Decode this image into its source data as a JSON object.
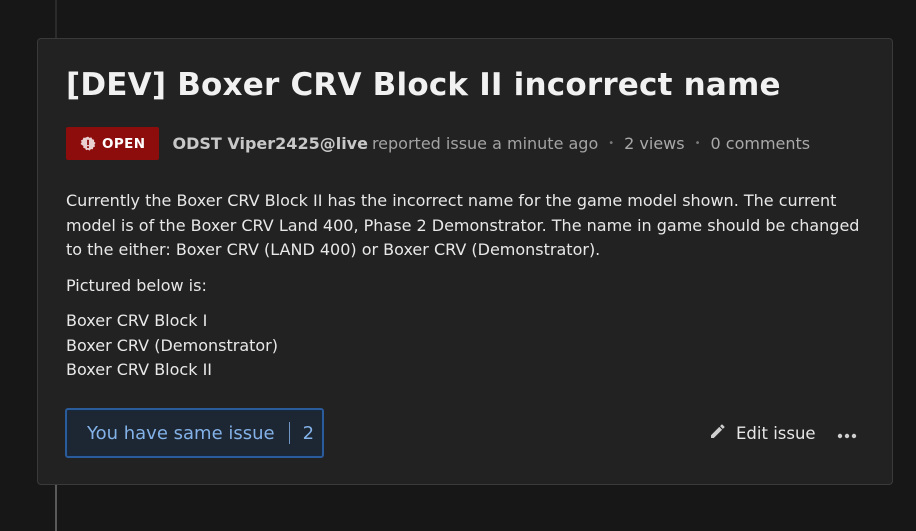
{
  "issue": {
    "title": "[DEV] Boxer CRV Block II incorrect name",
    "status": "OPEN",
    "status_icon": "gear-icon",
    "author": "ODST Viper2425@live",
    "reported_text": "reported issue a minute ago",
    "views": "2 views",
    "comments": "0 comments"
  },
  "body": {
    "paragraph_1": "Currently the Boxer CRV Block II has the incorrect name for the game model shown. The current model is of the Boxer CRV Land 400, Phase 2 Demonstrator. The name in game should be changed to the either: Boxer CRV (LAND 400) or Boxer CRV (Demonstrator).",
    "paragraph_2": "Pictured below is:",
    "list": [
      "Boxer CRV Block I",
      "Boxer CRV (Demonstrator)",
      "Boxer CRV Block II"
    ]
  },
  "actions": {
    "same_issue_label": "You have same issue",
    "same_issue_count": "2",
    "edit_label": "Edit issue",
    "edit_icon": "pencil-icon",
    "more_icon": "ellipsis-icon"
  },
  "colors": {
    "status_open": "#8d0c0c",
    "accent_blue": "#83b2e8",
    "card_bg": "#222222",
    "page_bg": "#171717"
  }
}
